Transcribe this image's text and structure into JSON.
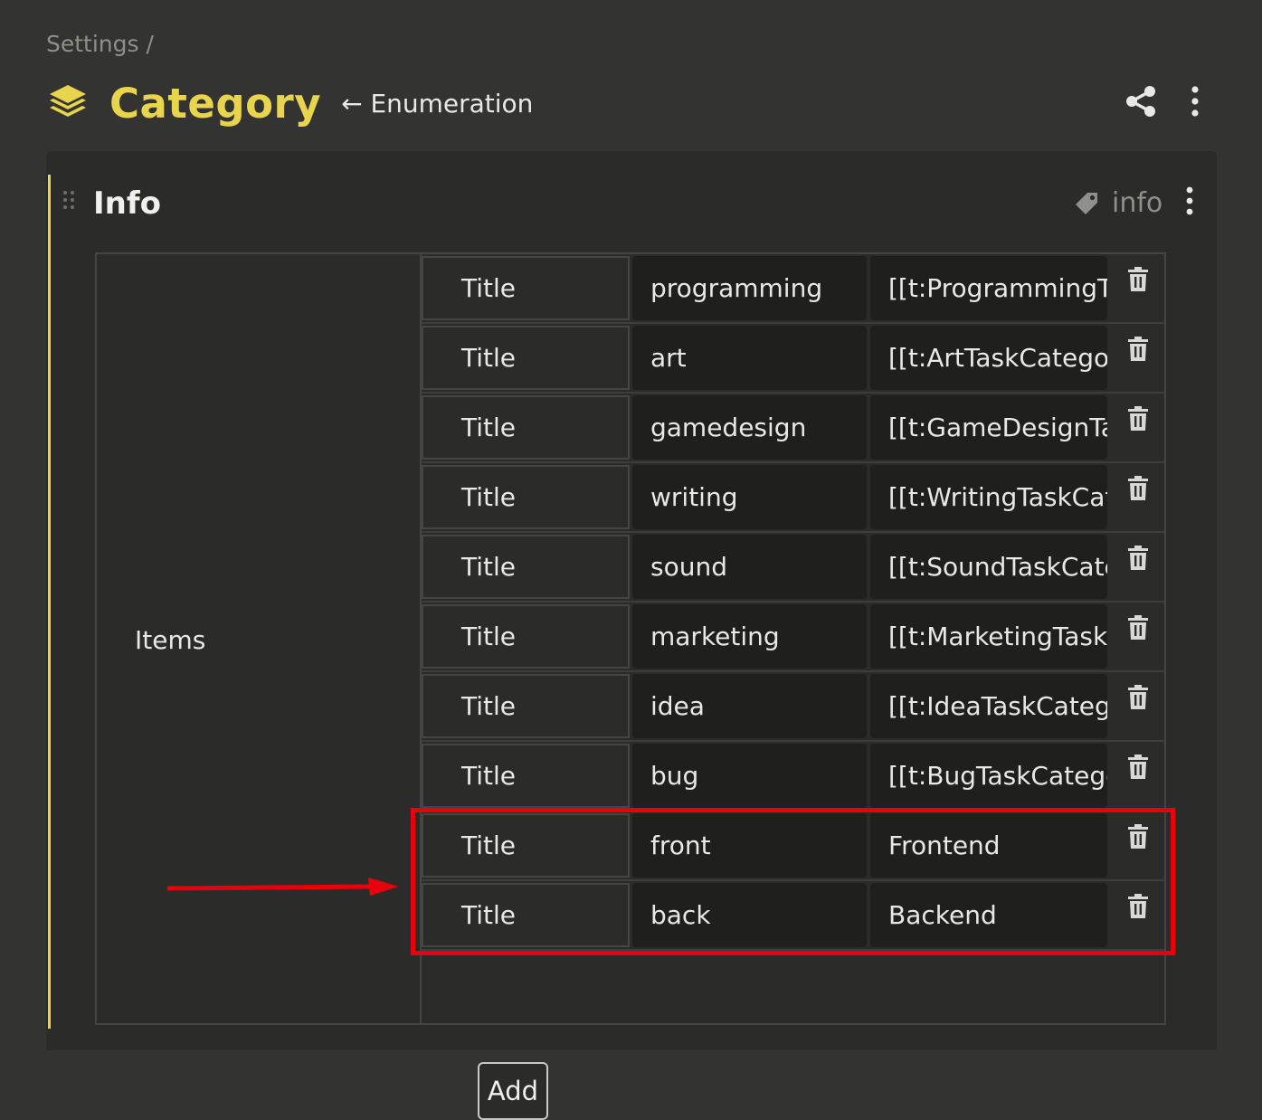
{
  "breadcrumb": "Settings /",
  "header": {
    "title": "Category",
    "subtitle": "← Enumeration",
    "accent_color": "#e9d44d",
    "icons": [
      "layers-icon",
      "share-icon",
      "more-vert-icon"
    ]
  },
  "panel": {
    "title": "Info",
    "tag": "info",
    "items_label": "Items",
    "rows": [
      {
        "label": "Title",
        "key": "programming",
        "value": "[[t:ProgrammingTaskCategory"
      },
      {
        "label": "Title",
        "key": "art",
        "value": "[[t:ArtTaskCategory"
      },
      {
        "label": "Title",
        "key": "gamedesign",
        "value": "[[t:GameDesignTaskCategory"
      },
      {
        "label": "Title",
        "key": "writing",
        "value": "[[t:WritingTaskCategory"
      },
      {
        "label": "Title",
        "key": "sound",
        "value": "[[t:SoundTaskCategory"
      },
      {
        "label": "Title",
        "key": "marketing",
        "value": "[[t:MarketingTaskCategory"
      },
      {
        "label": "Title",
        "key": "idea",
        "value": "[[t:IdeaTaskCategory"
      },
      {
        "label": "Title",
        "key": "bug",
        "value": "[[t:BugTaskCategory"
      },
      {
        "label": "Title",
        "key": "front",
        "value": "Frontend"
      },
      {
        "label": "Title",
        "key": "back",
        "value": "Backend"
      }
    ],
    "add_label": "Add"
  },
  "annotation_color": "#e8000a"
}
